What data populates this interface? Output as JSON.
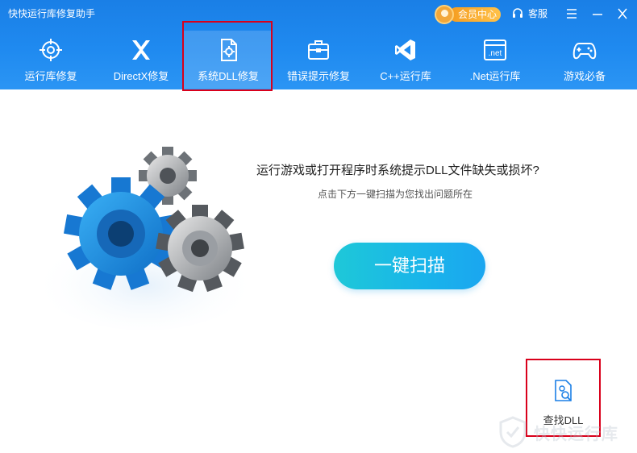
{
  "app": {
    "title": "快快运行库修复助手"
  },
  "topbar": {
    "vip_label": "会员中心",
    "service_label": "客服"
  },
  "nav": {
    "items": [
      {
        "label": "运行库修复",
        "icon": "target-icon"
      },
      {
        "label": "DirectX修复",
        "icon": "directx-icon"
      },
      {
        "label": "系统DLL修复",
        "icon": "dll-file-icon"
      },
      {
        "label": "错误提示修复",
        "icon": "toolbox-icon"
      },
      {
        "label": "C++运行库",
        "icon": "visual-studio-icon"
      },
      {
        "label": ".Net运行库",
        "icon": "dotnet-icon"
      },
      {
        "label": "游戏必备",
        "icon": "gamepad-icon"
      }
    ],
    "active_index": 2,
    "net_badge": ".net"
  },
  "main": {
    "question": "运行游戏或打开程序时系统提示DLL文件缺失或损坏?",
    "hint": "点击下方一键扫描为您找出问题所在",
    "scan_button": "一键扫描",
    "find_dll": "查找DLL"
  },
  "watermark": {
    "text": "快快运行库"
  },
  "colors": {
    "header": "#1f8af0",
    "scan_button": "#19b4ea",
    "highlight": "#d9001b"
  }
}
